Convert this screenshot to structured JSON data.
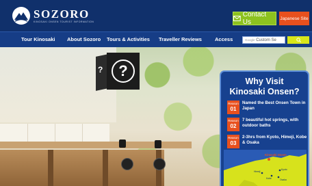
{
  "header": {
    "logo_word": "SOZORO",
    "logo_tagline": "KINOSAKI ONSEN TOURIST INFORMATION",
    "contact_label": "Contact Us",
    "japanese_site_label": "Japanese Site",
    "colors": {
      "header_bg": "#10306b",
      "contact_bg": "#8dc21f",
      "japanese_bg": "#e8501e"
    }
  },
  "nav": {
    "items": [
      {
        "label": "Tour Kinosaki"
      },
      {
        "label": "About Sozoro"
      },
      {
        "label": "Tours & Activities"
      },
      {
        "label": "Traveller Reviews"
      },
      {
        "label": "Access"
      }
    ],
    "search": {
      "brand": "Google",
      "placeholder": "Custom Se"
    },
    "search_button_icon": "search-icon"
  },
  "hero": {
    "sign_icon": "question-mark-icon",
    "panel": {
      "title_line1": "Why Visit",
      "title_line2": "Kinosaki Onsen?",
      "reasons": [
        {
          "word": "Reason",
          "number": "01",
          "text": "Named the Best Onsen Town in Japan"
        },
        {
          "word": "Reason",
          "number": "02",
          "text": "7 beautiful hot springs, with outdoor baths"
        },
        {
          "word": "Reason",
          "number": "03",
          "text": "2-3hrs from Kyoto, Himeji, Kobe & Osaka"
        }
      ],
      "map": {
        "highlight": "Kinosaki Onsen",
        "cities": [
          "Kyoto",
          "Himeji",
          "Kobe",
          "Osaka"
        ]
      }
    }
  }
}
